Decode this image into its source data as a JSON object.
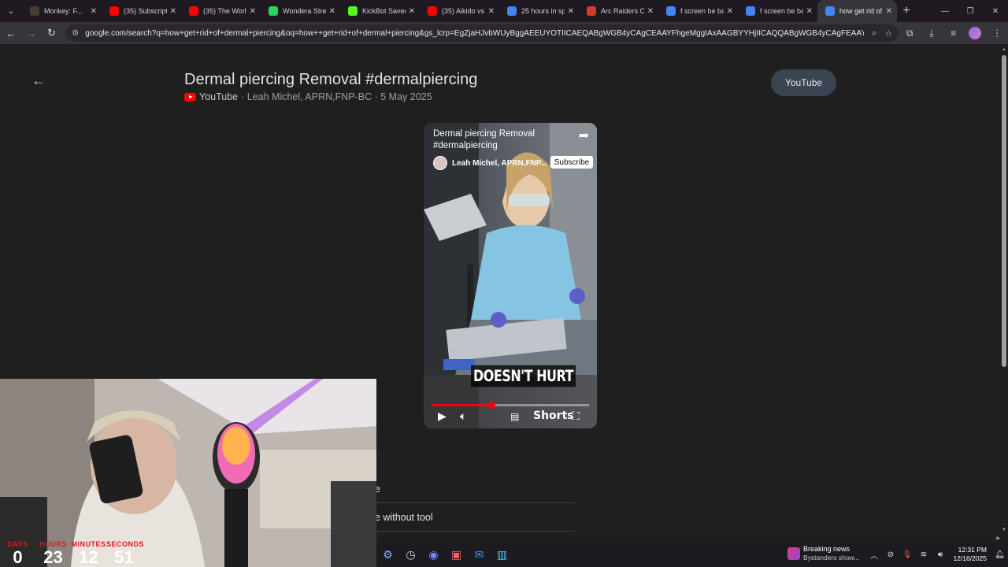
{
  "browser": {
    "tabs": [
      {
        "label": "Monkey: F...",
        "icon_color": "#4a3c2f",
        "icon": "monkey-icon"
      },
      {
        "label": "(35) Subscripti...",
        "icon_color": "#ff0000",
        "icon": "youtube-icon"
      },
      {
        "label": "(35) The World...",
        "icon_color": "#ff0000",
        "icon": "youtube-icon"
      },
      {
        "label": "Wondera Strea...",
        "icon_color": "#2bd35a",
        "icon": "wondera-icon"
      },
      {
        "label": "KickBot Saved...",
        "icon_color": "#53fc18",
        "icon": "kickbot-icon"
      },
      {
        "label": "(35) Aikido vs...",
        "icon_color": "#ff0000",
        "icon": "youtube-icon"
      },
      {
        "label": "25 hours in sp...",
        "icon_color": "#4285f4",
        "icon": "google-icon"
      },
      {
        "label": "Arc Raiders Co...",
        "icon_color": "#d63a2f",
        "icon": "arc-raiders-icon"
      },
      {
        "label": "f screen be ba...",
        "icon_color": "#4285f4",
        "icon": "google-icon"
      },
      {
        "label": "f screen be ba...",
        "icon_color": "#4285f4",
        "icon": "google-icon"
      },
      {
        "label": "how get rid of...",
        "icon_color": "#4285f4",
        "icon": "google-icon",
        "active": true
      }
    ],
    "url": "google.com/search?q=how+get+rid+of+dermal+piercing&oq=how++get+rid+of+dermal+piercing&gs_lcrp=EgZjaHJvbWUyBggAEEUYOTIICAEQABgWGB4yCAgCEAAYFhgeMggIAxAAGBYYHjIICAQQABgWGB4yCAgFEAAYFhgeMggIBhAA..."
  },
  "video": {
    "title": "Dermal piercing Removal #dermalpiercing",
    "source": "YouTube",
    "meta": "· Leah Michel, APRN,FNP-BC · 5 May 2025",
    "youtube_button": "YouTube",
    "back_label": "←"
  },
  "player": {
    "title": "Dermal piercing Removal #dermalpiercing",
    "channel": "Leah Michel, APRN,FNP...",
    "subscribe": "Subscribe",
    "caption": "DOESN'T HURT",
    "shorts": "Shorts",
    "progress": 0.38
  },
  "results": {
    "item1": "e",
    "item2": "e without tool"
  },
  "webcam": {
    "timer": [
      {
        "label": "DAYS",
        "value": "0"
      },
      {
        "label": "HOURS",
        "value": "23"
      },
      {
        "label": "MINUTES",
        "value": "12"
      },
      {
        "label": "SECONDS",
        "value": "51"
      }
    ]
  },
  "taskbar": {
    "news_title": "Breaking news",
    "news_sub": "Bystanders show...",
    "time": "12:31 PM",
    "date": "12/16/2025"
  }
}
